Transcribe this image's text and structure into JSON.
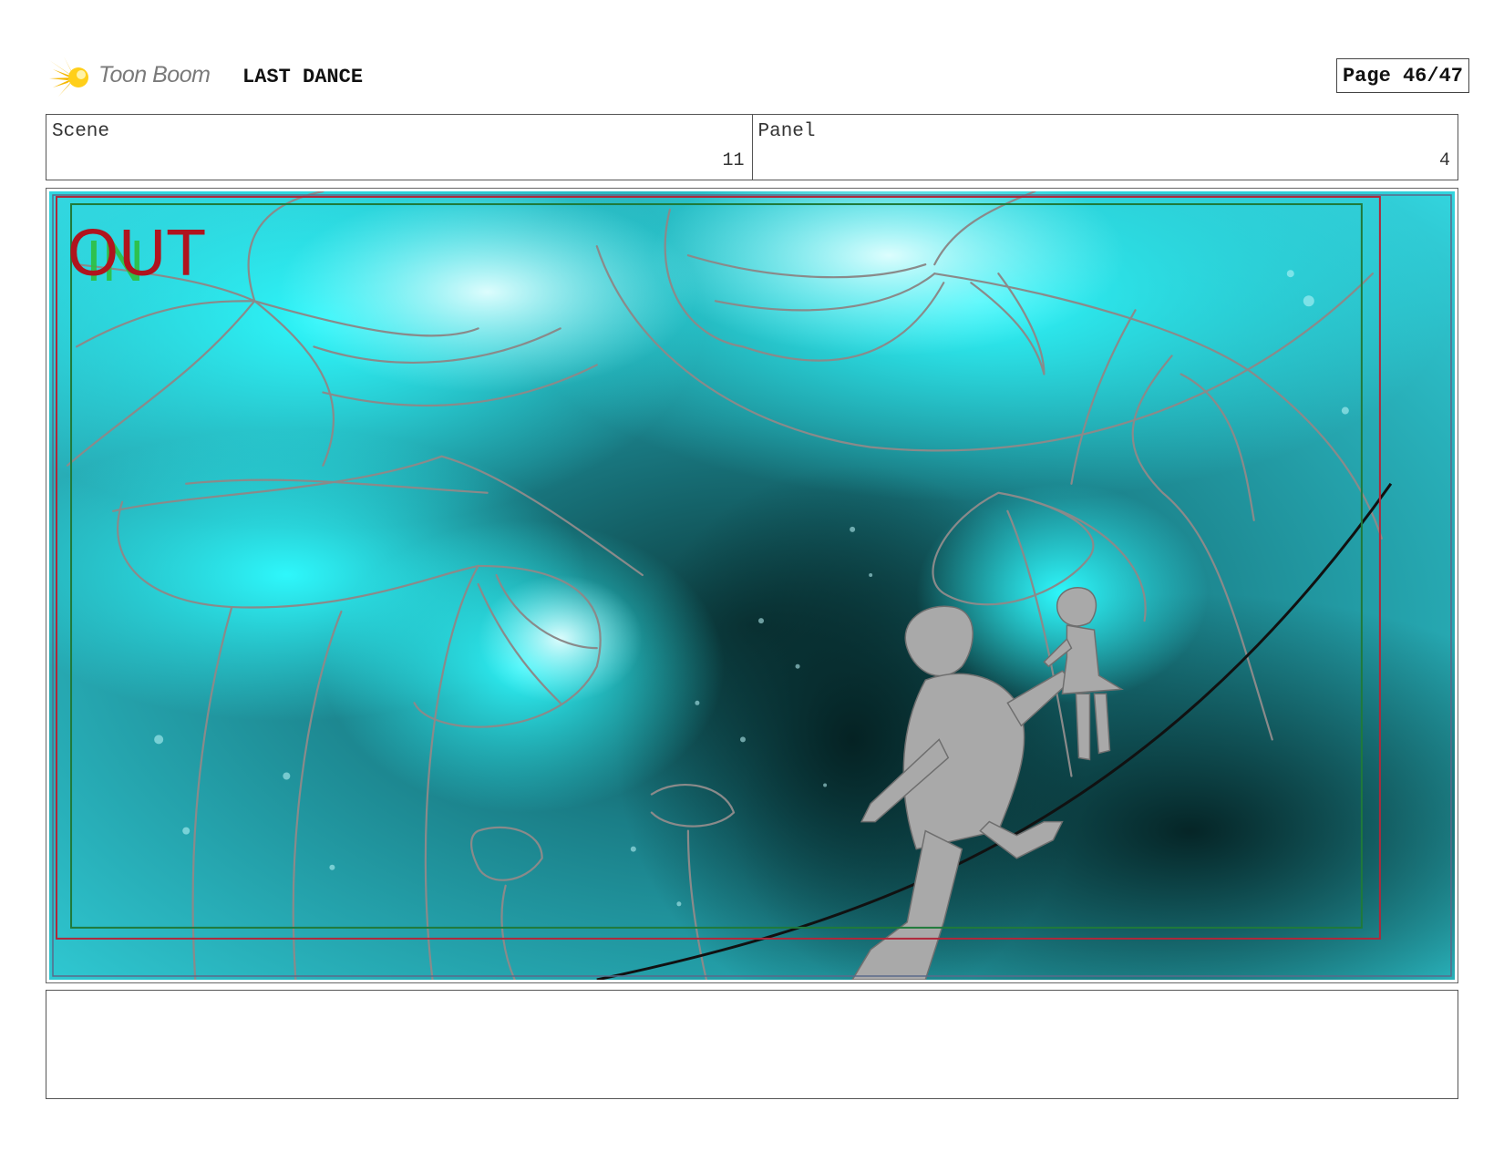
{
  "header": {
    "brand": "Toon Boom",
    "project_title": "LAST DANCE",
    "page_label": "Page 46/47"
  },
  "info": {
    "scene_label": "Scene",
    "scene_value": "11",
    "panel_label": "Panel",
    "panel_value": "4"
  },
  "panel_art": {
    "overlay_out": "OUT",
    "overlay_in": "IN",
    "colors": {
      "cyan_glow": "#2ef2f7",
      "deep_teal": "#062a2b",
      "sketch_line": "#8a8a8a",
      "figure_fill": "#a9a9a9",
      "safe_red": "#b0283a",
      "safe_green": "#1f7a3a"
    }
  },
  "notes": {
    "text": ""
  }
}
